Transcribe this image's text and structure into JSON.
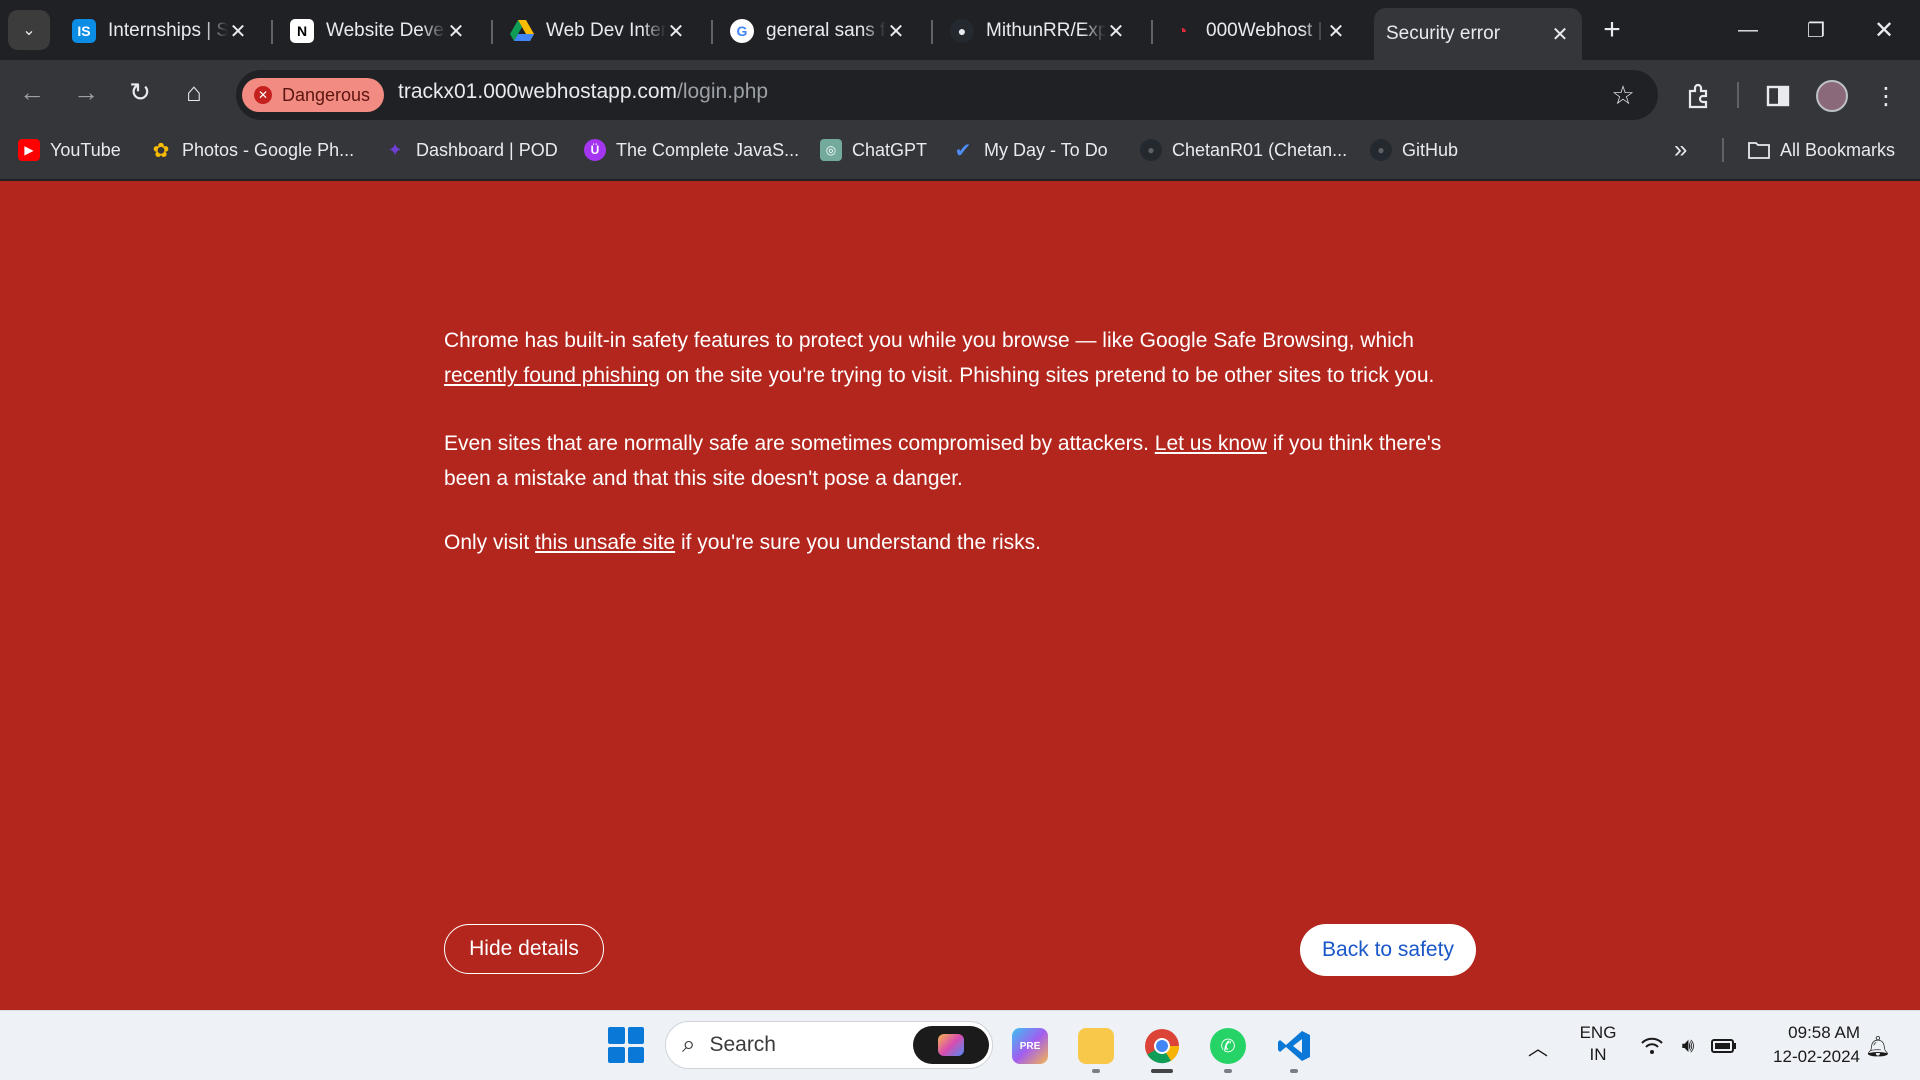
{
  "tabs": [
    {
      "title": "Internships | S",
      "favicon": "IS"
    },
    {
      "title": "Website Devel",
      "favicon": "N"
    },
    {
      "title": "Web Dev Inter",
      "favicon": "drive"
    },
    {
      "title": "general sans f",
      "favicon": "G"
    },
    {
      "title": "MithunRR/Exp",
      "favicon": "github"
    },
    {
      "title": "000Webhost |",
      "favicon": "000"
    },
    {
      "title": "Security error",
      "favicon": ""
    }
  ],
  "toolbar": {
    "security_chip": "Dangerous",
    "url_host": "trackx01.000webhostapp.com",
    "url_path": "/login.php"
  },
  "bookmarks": [
    {
      "label": "YouTube",
      "color": "#ff0000",
      "glyph": "▶"
    },
    {
      "label": "Photos - Google Ph...",
      "color": "#fbbc04",
      "glyph": "✿"
    },
    {
      "label": "Dashboard | POD",
      "color": "#6e3fd4",
      "glyph": "✦"
    },
    {
      "label": "The Complete JavaS...",
      "color": "#a435f0",
      "glyph": "Ü"
    },
    {
      "label": "ChatGPT",
      "color": "#74aa9c",
      "glyph": "◎"
    },
    {
      "label": "My Day - To Do",
      "color": "#2564cf",
      "glyph": "✔"
    },
    {
      "label": "ChetanR01 (Chetan...",
      "color": "#24292f",
      "glyph": "●"
    },
    {
      "label": "GitHub",
      "color": "#24292f",
      "glyph": "●"
    }
  ],
  "all_bookmarks_label": "All Bookmarks",
  "warning": {
    "para1_before": "Chrome has built-in safety features to protect you while you browse — like Google Safe Browsing, which ",
    "para1_link": "recently found phishing",
    "para1_after": " on the site you're trying to visit. Phishing sites pretend to be other sites to trick you.",
    "para2_before": "Even sites that are normally safe are sometimes compromised by attackers. ",
    "para2_link": "Let us know",
    "para2_after": " if you think there's been a mistake and that this site doesn't pose a danger.",
    "para3_before": "Only visit ",
    "para3_link": "this unsafe site",
    "para3_after": " if you're sure you understand the risks.",
    "hide_details_label": "Hide details",
    "back_to_safety_label": "Back to safety"
  },
  "taskbar": {
    "search_placeholder": "Search",
    "lang_line1": "ENG",
    "lang_line2": "IN",
    "time": "09:58 AM",
    "date": "12-02-2024"
  },
  "colors": {
    "danger_background": "#b3261e",
    "chip": "#f28b82",
    "back_button_text": "#1a57c9"
  }
}
